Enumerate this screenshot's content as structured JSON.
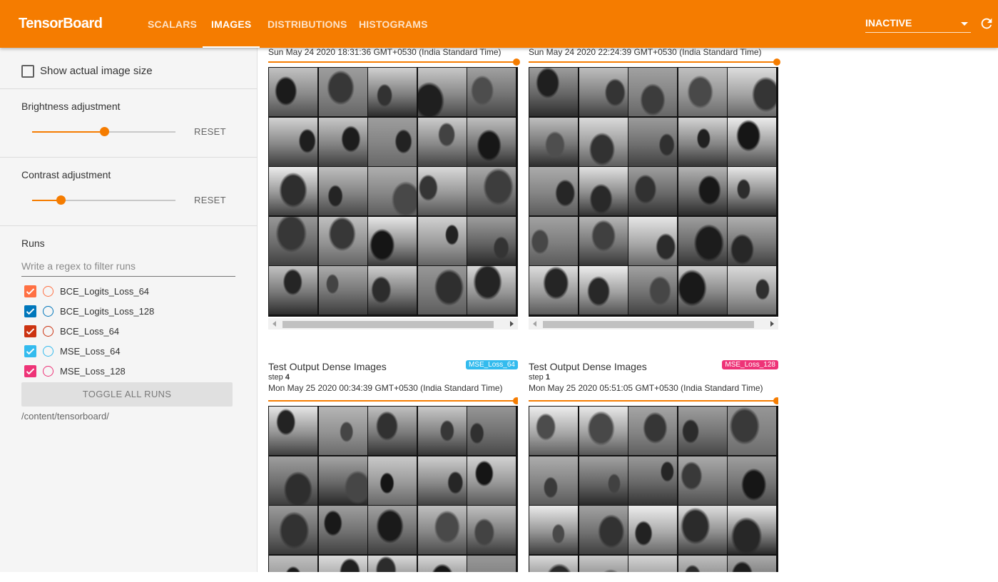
{
  "header": {
    "brand": "TensorBoard",
    "tabs": [
      {
        "label": "SCALARS",
        "active": false
      },
      {
        "label": "IMAGES",
        "active": true
      },
      {
        "label": "DISTRIBUTIONS",
        "active": false
      },
      {
        "label": "HISTOGRAMS",
        "active": false
      }
    ],
    "status_select": "INACTIVE",
    "reload_icon": "reload-icon"
  },
  "sidebar": {
    "show_actual_size_label": "Show actual image size",
    "show_actual_size_checked": false,
    "brightness": {
      "title": "Brightness adjustment",
      "reset": "RESET",
      "value": 0.5
    },
    "contrast": {
      "title": "Contrast adjustment",
      "reset": "RESET",
      "value": 0.2
    },
    "runs_title": "Runs",
    "filter_placeholder": "Write a regex to filter runs",
    "runs": [
      {
        "name": "BCE_Logits_Loss_64",
        "color": "#ff7043",
        "checked": true
      },
      {
        "name": "BCE_Logits_Loss_128",
        "color": "#0077bb",
        "checked": true
      },
      {
        "name": "BCE_Loss_64",
        "color": "#cc3311",
        "checked": true
      },
      {
        "name": "MSE_Loss_64",
        "color": "#33bbee",
        "checked": true
      },
      {
        "name": "MSE_Loss_128",
        "color": "#ee3377",
        "checked": true
      }
    ],
    "toggle_all": "TOGGLE ALL RUNS",
    "logdir": "/content/tensorboard/"
  },
  "cards": {
    "top_left": {
      "time": "Sun May 24 2020 18:31:36 GMT+0530 (India Standard Time)"
    },
    "top_right": {
      "time": "Sun May 24 2020 22:24:39 GMT+0530 (India Standard Time)"
    },
    "bottom_left": {
      "title": "Test Output Dense Images",
      "step_label": "step",
      "step": "4",
      "time": "Mon May 25 2020 00:34:39 GMT+0530 (India Standard Time)",
      "run": "MSE_Loss_64",
      "run_color": "#33bbee"
    },
    "bottom_right": {
      "title": "Test Output Dense Images",
      "step_label": "step",
      "step": "1",
      "time": "Mon May 25 2020 05:51:05 GMT+0530 (India Standard Time)",
      "run": "MSE_Loss_128",
      "run_color": "#ee3377"
    }
  }
}
